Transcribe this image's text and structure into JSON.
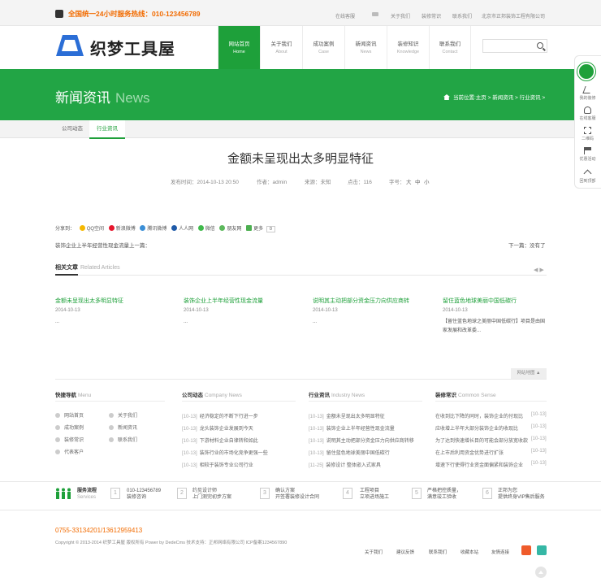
{
  "topbar": {
    "hotline": "全国统一24小时服务热线：010-123456789",
    "links": [
      "在线客服",
      "关于我们",
      "装修常识",
      "联系我们",
      "北京市正邦装饰工程有限公司"
    ]
  },
  "header": {
    "logo_text": "织梦工具屋",
    "nav": [
      {
        "cn": "网站首页",
        "en": "Home"
      },
      {
        "cn": "关于我们",
        "en": "About"
      },
      {
        "cn": "成功案例",
        "en": "Case"
      },
      {
        "cn": "新闻资讯",
        "en": "News"
      },
      {
        "cn": "装修知识",
        "en": "Knowledge"
      },
      {
        "cn": "联系我们",
        "en": "Contact"
      }
    ],
    "search_placeholder": ""
  },
  "banner": {
    "title_cn": "新闻资讯",
    "title_en": "News",
    "breadcrumb": "当前位置:主页 > 新闻资讯 > 行业资讯 >"
  },
  "subnav": [
    "公司动态",
    "行业资讯"
  ],
  "article": {
    "title": "金额未呈现出太多明显特征",
    "published": "发布时间：2014-10-13 20:50",
    "author": "作者：admin",
    "source": "来源：未知",
    "clicks": "点击：116",
    "fontsize_label": "字号：",
    "fontsizes": [
      "大",
      "中",
      "小"
    ],
    "share_label": "分享到：",
    "share_items": [
      "QQ空间",
      "新浪微博",
      "腾讯微博",
      "人人网",
      "微信",
      "朋友网",
      "更多"
    ],
    "share_count": "0",
    "prev": "装饰企业上半年经营性现金流量",
    "prev_label": "上一篇：",
    "next": "下一篇：没有了"
  },
  "related": {
    "title_cn": "相关文章",
    "title_en": "Related Articles",
    "arrows": "◀ ▶",
    "items": [
      {
        "title": "金额未呈现出太多明显特征",
        "date": "2014-10-13",
        "desc": "..."
      },
      {
        "title": "装饰企业上半年经营性现金流量",
        "date": "2014-10-13",
        "desc": "..."
      },
      {
        "title": "说明其主动把部分资金压力向供应商转",
        "date": "2014-10-13",
        "desc": "..."
      },
      {
        "title": "留住蓝色地球美丽中国低碳行",
        "date": "2014-10-13",
        "desc": "【留住蓝色地球之美丽中国低碳行】项目是由国家发展和改革委..."
      }
    ]
  },
  "footer": {
    "sitemap": "网站地图 ▲",
    "quick_nav": {
      "title_cn": "快捷导航",
      "title_en": "Menu",
      "items": [
        "网站首页",
        "关于我们",
        "成功案例",
        "新闻资讯",
        "装修常识",
        "联系我们",
        "代表客户"
      ]
    },
    "company_news": {
      "title_cn": "公司动态",
      "title_en": "Company News",
      "items": [
        {
          "date": "[10-13]",
          "title": "经济稳定的不断下行进一步"
        },
        {
          "date": "[10-13]",
          "title": "龙头装饰企业发展到今天"
        },
        {
          "date": "[10-13]",
          "title": "下游材料企业自律转和如此"
        },
        {
          "date": "[10-13]",
          "title": "装饰行业的市场化竞争更强一些"
        },
        {
          "date": "[10-13]",
          "title": "相较于装饰专业公司行业"
        }
      ]
    },
    "industry_news": {
      "title_cn": "行业资讯",
      "title_en": "Industry News",
      "items": [
        {
          "date": "[10-13]",
          "title": "金额未呈现出太多明显特征"
        },
        {
          "date": "[10-13]",
          "title": "装饰企业上半年经营性现金流量"
        },
        {
          "date": "[10-13]",
          "title": "说明其主动把部分资金压力向供应商转移"
        },
        {
          "date": "[10-13]",
          "title": "留住蓝色地球美丽中国低碳行"
        },
        {
          "date": "[11-25]",
          "title": "装修设计 整体嵌入式家具"
        }
      ]
    },
    "common_sense": {
      "title_cn": "装修常识",
      "title_en": "Common Sense",
      "items": [
        {
          "title": "在收到比下降的同时，装饰企业的付现比",
          "date": "[10-13]"
        },
        {
          "title": "应收增上半年大部分装饰企业的收现比",
          "date": "[10-13]"
        },
        {
          "title": "为了达到快速增长目的可能会部分放宽收款",
          "date": "[10-13]"
        },
        {
          "title": "在上市后利用资金优势进行扩张",
          "date": "[10-13]"
        },
        {
          "title": "增速下行使得行业资金面偏紧和装饰企业",
          "date": "[10-13]"
        }
      ]
    },
    "process": {
      "title_cn": "服务流程",
      "title_en": "Services",
      "steps": [
        {
          "num": "1",
          "l1": "010-123456789",
          "l2": "装修咨询"
        },
        {
          "num": "2",
          "l1": "约见设计师",
          "l2": "上门测完初步方案"
        },
        {
          "num": "3",
          "l1": "确认方案",
          "l2": "开签署装修设计合同"
        },
        {
          "num": "4",
          "l1": "工程项目",
          "l2": "立项进场施工"
        },
        {
          "num": "5",
          "l1": "严格把控质量，",
          "l2": "满意竣工验收"
        },
        {
          "num": "6",
          "l1": "正邦为您",
          "l2": "提供终身VIP售后服务"
        }
      ]
    },
    "phone": "0755-33134201/13612959413",
    "copyright": "Copyright © 2013-2014 织梦工具屋 版权所有 Power by DedeCms 技术支持：正邦网络有限公司 ICP备案1234567890",
    "bottom_links": [
      "关于我们",
      "建议反馈",
      "联系我们",
      "收藏本站",
      "友情连接"
    ]
  },
  "float_bar": [
    "我的装修",
    "在线客服",
    "二维码",
    "优惠活动",
    "回到顶部"
  ],
  "colors": {
    "brand_green": "#1ea03a",
    "hotline_orange": "#f26b00"
  }
}
